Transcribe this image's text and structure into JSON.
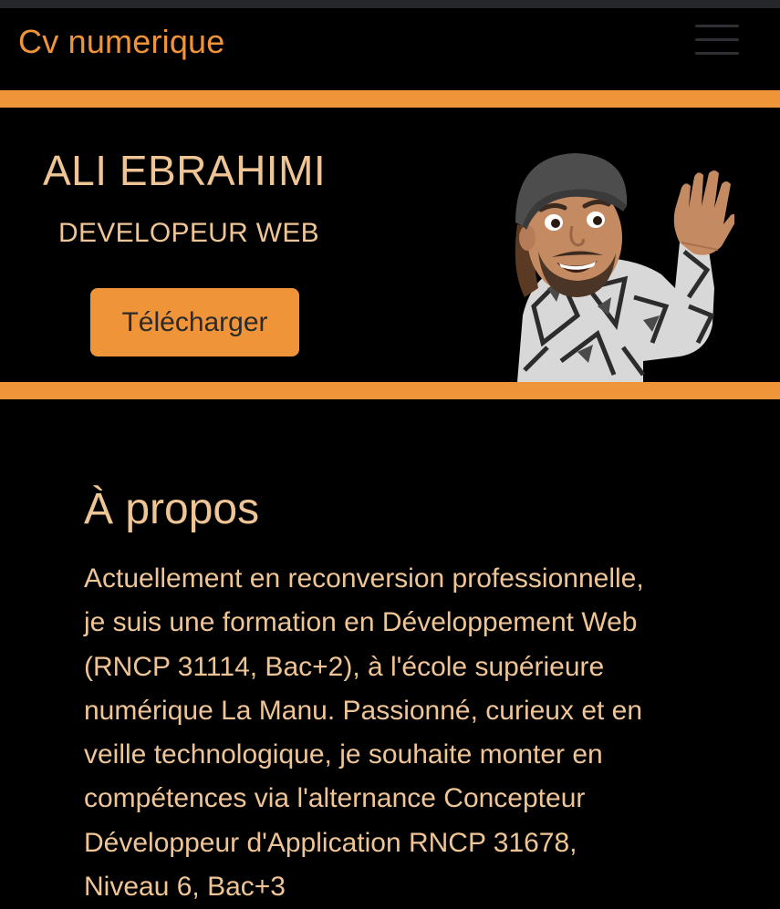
{
  "navbar": {
    "brand": "Cv numerique",
    "menu_icon": "hamburger-menu-icon"
  },
  "hero": {
    "name": "ALI EBRAHIMI",
    "role": "DEVELOPEUR WEB",
    "download_label": "Télécharger",
    "avatar_icon": "memoji-avatar-waving"
  },
  "about": {
    "title": "À propos",
    "lines": [
      "Actuellement en reconversion professionnelle,",
      "je suis une formation en Développement Web",
      "(RNCP 31114, Bac+2), à l'école supérieure",
      "numérique La Manu. Passionné, curieux et en",
      "veille technologique, je souhaite monter en",
      "compétences via l'alternance Concepteur",
      "Développeur d'Application RNCP 31678,",
      "Niveau 6, Bac+3"
    ]
  },
  "colors": {
    "accent": "#f0943a",
    "text": "#efc596",
    "background": "#000000"
  }
}
